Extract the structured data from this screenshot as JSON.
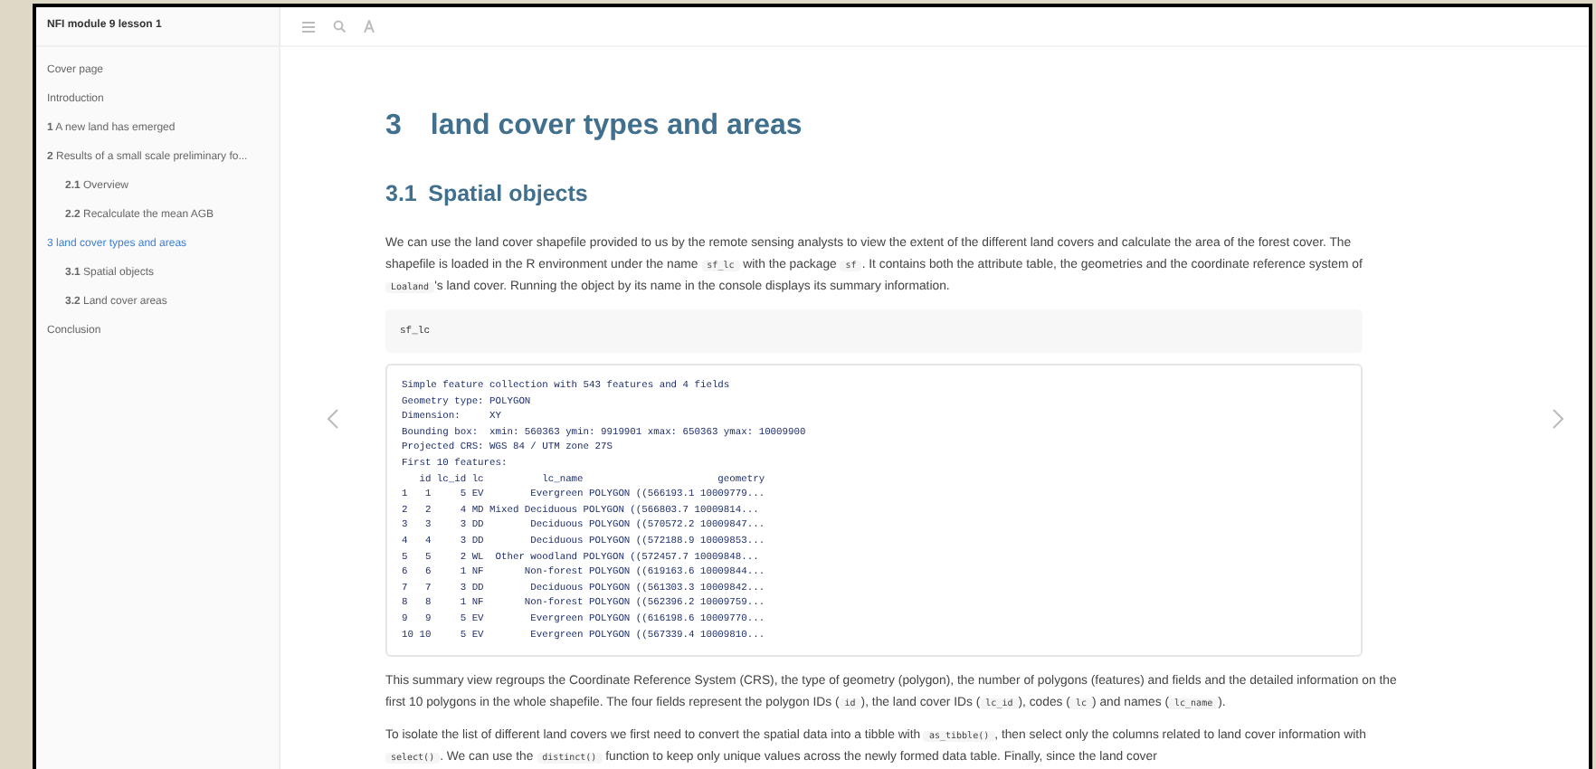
{
  "book_title": "NFI module 9 lesson 1",
  "toc": [
    {
      "text": "Cover page",
      "selected": false
    },
    {
      "text": "Introduction",
      "selected": false
    },
    {
      "text": "**1** A new land has emerged",
      "selected": false
    },
    {
      "text": "**2** Results of a small scale preliminary fo...",
      "selected": false,
      "children": [
        {
          "text": "**2.1** Overview",
          "selected": false
        },
        {
          "text": "**2.2** Recalculate the mean AGB",
          "selected": false
        }
      ]
    },
    {
      "text": "3 land cover types and areas",
      "selected": true,
      "children": [
        {
          "text": "**3.1** Spatial objects",
          "selected": false
        },
        {
          "text": "**3.2** Land cover areas",
          "selected": false
        }
      ]
    },
    {
      "text": "Conclusion",
      "selected": false
    }
  ],
  "chapter": {
    "number": "3",
    "title": "land cover types and areas"
  },
  "section": {
    "number": "3.1",
    "title": "Spatial objects"
  },
  "blocks": [
    {
      "kind": "paragraph",
      "parts": [
        {
          "kind": "text",
          "text": "We can use the land cover shapefile provided to us by the remote sensing analysts to view the extent of the different land covers and calculate the area of the forest cover. The shapefile is loaded in the R environment under the name "
        },
        {
          "kind": "code",
          "text": "sf_lc"
        },
        {
          "kind": "text",
          "text": " with the package "
        },
        {
          "kind": "code",
          "text": "sf"
        },
        {
          "kind": "text",
          "text": ". It contains both the attribute table, the geometries and the coordinate reference system of "
        },
        {
          "kind": "code",
          "text": "Loaland"
        },
        {
          "kind": "text",
          "text": "'s land cover. Running the object by its name in the console displays its summary information."
        }
      ]
    },
    {
      "kind": "code_input",
      "text": "sf_lc"
    },
    {
      "kind": "code_output",
      "text": "Simple feature collection with 543 features and 4 fields\nGeometry type: POLYGON\nDimension:     XY\nBounding box:  xmin: 560363 ymin: 9919901 xmax: 650363 ymax: 10009900\nProjected CRS: WGS 84 / UTM zone 27S\nFirst 10 features:\n   id lc_id lc          lc_name                       geometry\n1   1     5 EV        Evergreen POLYGON ((566193.1 10009779...\n2   2     4 MD Mixed Deciduous POLYGON ((566803.7 10009814...\n3   3     3 DD        Deciduous POLYGON ((570572.2 10009847...\n4   4     3 DD        Deciduous POLYGON ((572188.9 10009853...\n5   5     2 WL  Other woodland POLYGON ((572457.7 10009848...\n6   6     1 NF       Non-forest POLYGON ((619163.6 10009844...\n7   7     3 DD        Deciduous POLYGON ((561303.3 10009842...\n8   8     1 NF       Non-forest POLYGON ((562396.2 10009759...\n9   9     5 EV        Evergreen POLYGON ((616198.6 10009770...\n10 10     5 EV        Evergreen POLYGON ((567339.4 10009810..."
    },
    {
      "kind": "paragraph",
      "parts": [
        {
          "kind": "text",
          "text": "This summary view regroups the Coordinate Reference System (CRS), the type of geometry (polygon), the number of polygons (features) and fields and the detailed information on the first 10 polygons in the whole shapefile. The four fields represent the polygon IDs ("
        },
        {
          "kind": "code",
          "text": "id"
        },
        {
          "kind": "text",
          "text": "), the land cover IDs ("
        },
        {
          "kind": "code",
          "text": "lc_id"
        },
        {
          "kind": "text",
          "text": "), codes ("
        },
        {
          "kind": "code",
          "text": "lc"
        },
        {
          "kind": "text",
          "text": ") and names ("
        },
        {
          "kind": "code",
          "text": "lc_name"
        },
        {
          "kind": "text",
          "text": ")."
        }
      ]
    },
    {
      "kind": "paragraph",
      "parts": [
        {
          "kind": "text",
          "text": "To isolate the list of different land covers we first need to convert the spatial data into a tibble with "
        },
        {
          "kind": "code",
          "text": "as_tibble()"
        },
        {
          "kind": "text",
          "text": ", then select only the columns related to land cover information with "
        },
        {
          "kind": "code",
          "text": "select()"
        },
        {
          "kind": "text",
          "text": ". We can use the "
        },
        {
          "kind": "code",
          "text": "distinct()"
        },
        {
          "kind": "text",
          "text": " function to keep only unique values across the newly formed data table. Finally, since the land cover"
        }
      ]
    }
  ]
}
